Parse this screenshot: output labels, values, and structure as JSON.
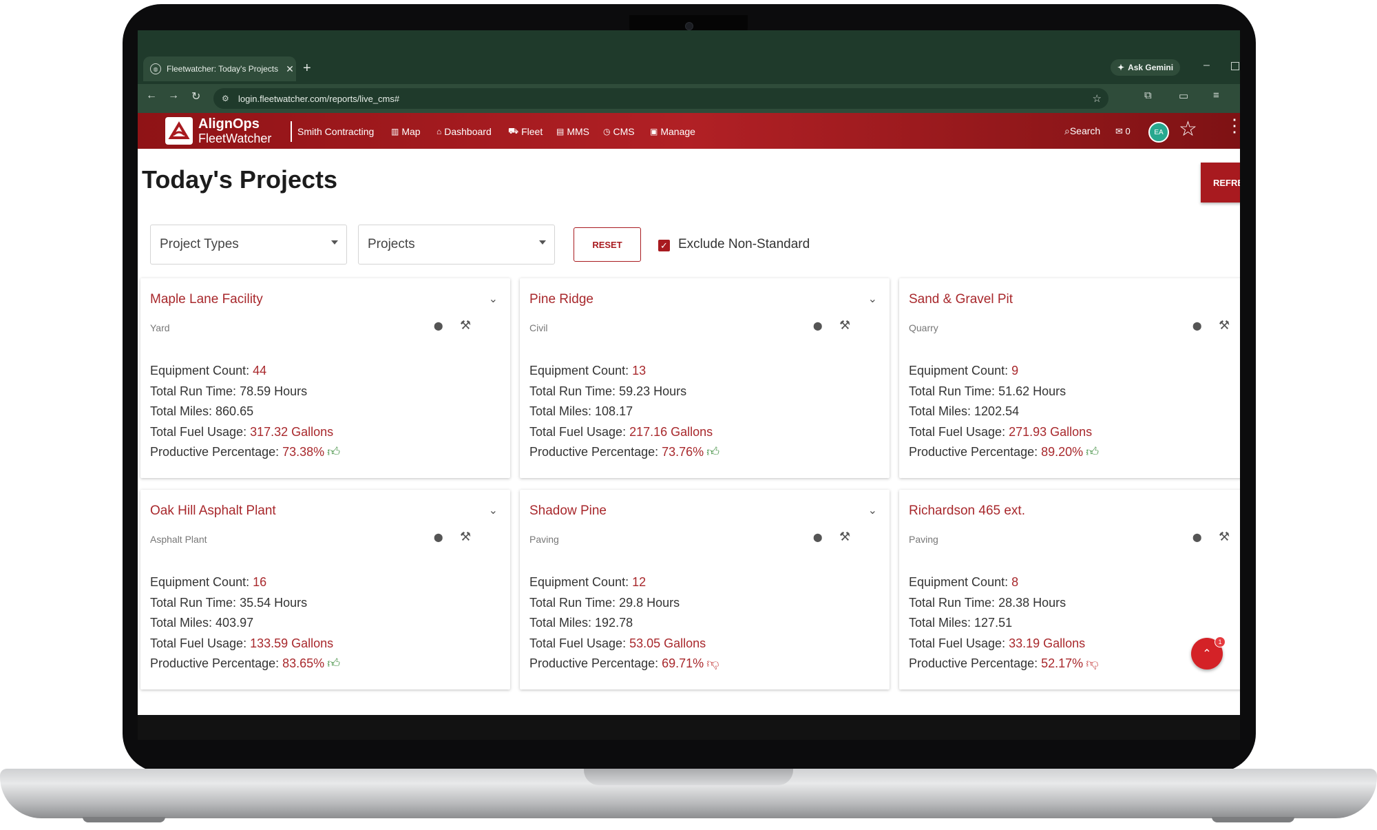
{
  "browser": {
    "tab_title": "Fleetwatcher: Today's Projects",
    "tab_close": "✕",
    "new_tab": "+",
    "url": "login.fleetwatcher.com/reports/live_cms#",
    "gemini_label": "Ask Gemini",
    "back": "←",
    "forward": "→",
    "reload": "↻"
  },
  "header": {
    "brand_line1": "AlignOps",
    "brand_line2": "FleetWatcher",
    "company": "Smith Contracting",
    "nav": [
      {
        "icon": "map-icon",
        "glyph": "▥",
        "label": "Map"
      },
      {
        "icon": "home-icon",
        "glyph": "⌂",
        "label": "Dashboard"
      },
      {
        "icon": "truck-icon",
        "glyph": "⛟",
        "label": "Fleet"
      },
      {
        "icon": "document-icon",
        "glyph": "▤",
        "label": "MMS"
      },
      {
        "icon": "clock-icon",
        "glyph": "◷",
        "label": "CMS"
      },
      {
        "icon": "briefcase-icon",
        "glyph": "▣",
        "label": "Manage"
      }
    ],
    "search_label": "Search",
    "mail_count": "0",
    "avatar_initials": "EA"
  },
  "page": {
    "title": "Today's Projects",
    "refresh_label": "REFRE",
    "filter_project_types": "Project Types",
    "filter_projects": "Projects",
    "reset_label": "RESET",
    "exclude_label": "Exclude Non-Standard",
    "exclude_checked": true
  },
  "labels": {
    "equipment": "Equipment Count: ",
    "runtime": "Total Run Time: ",
    "miles": "Total Miles: ",
    "fuel": "Total Fuel Usage: ",
    "productive": "Productive Percentage: "
  },
  "projects": [
    {
      "name": "Maple Lane Facility",
      "type": "Yard",
      "equipment": "44",
      "runtime": "78.59 Hours",
      "miles": "860.65",
      "fuel": "317.32 Gallons",
      "productive": "73.38%",
      "trend": "up",
      "collapsible": true
    },
    {
      "name": "Pine Ridge",
      "type": "Civil",
      "equipment": "13",
      "runtime": "59.23 Hours",
      "miles": "108.17",
      "fuel": "217.16 Gallons",
      "productive": "73.76%",
      "trend": "up",
      "collapsible": true
    },
    {
      "name": "Sand & Gravel Pit",
      "type": "Quarry",
      "equipment": "9",
      "runtime": "51.62 Hours",
      "miles": "1202.54",
      "fuel": "271.93 Gallons",
      "productive": "89.20%",
      "trend": "up",
      "collapsible": false
    },
    {
      "name": "Oak Hill Asphalt Plant",
      "type": "Asphalt Plant",
      "equipment": "16",
      "runtime": "35.54 Hours",
      "miles": "403.97",
      "fuel": "133.59 Gallons",
      "productive": "83.65%",
      "trend": "up",
      "collapsible": true
    },
    {
      "name": "Shadow Pine",
      "type": "Paving",
      "equipment": "12",
      "runtime": "29.8 Hours",
      "miles": "192.78",
      "fuel": "53.05 Gallons",
      "productive": "69.71%",
      "trend": "down",
      "collapsible": true
    },
    {
      "name": "Richardson 465 ext.",
      "type": "Paving",
      "equipment": "8",
      "runtime": "28.38 Hours",
      "miles": "127.51",
      "fuel": "33.19 Gallons",
      "productive": "52.17%",
      "trend": "down",
      "collapsible": false
    }
  ],
  "fab": {
    "badge": "1"
  },
  "colors": {
    "brand_red": "#a81a1f",
    "accent_text": "#a8282c",
    "thumb_up": "#3a8a3a",
    "thumb_down": "#c94a4a"
  }
}
